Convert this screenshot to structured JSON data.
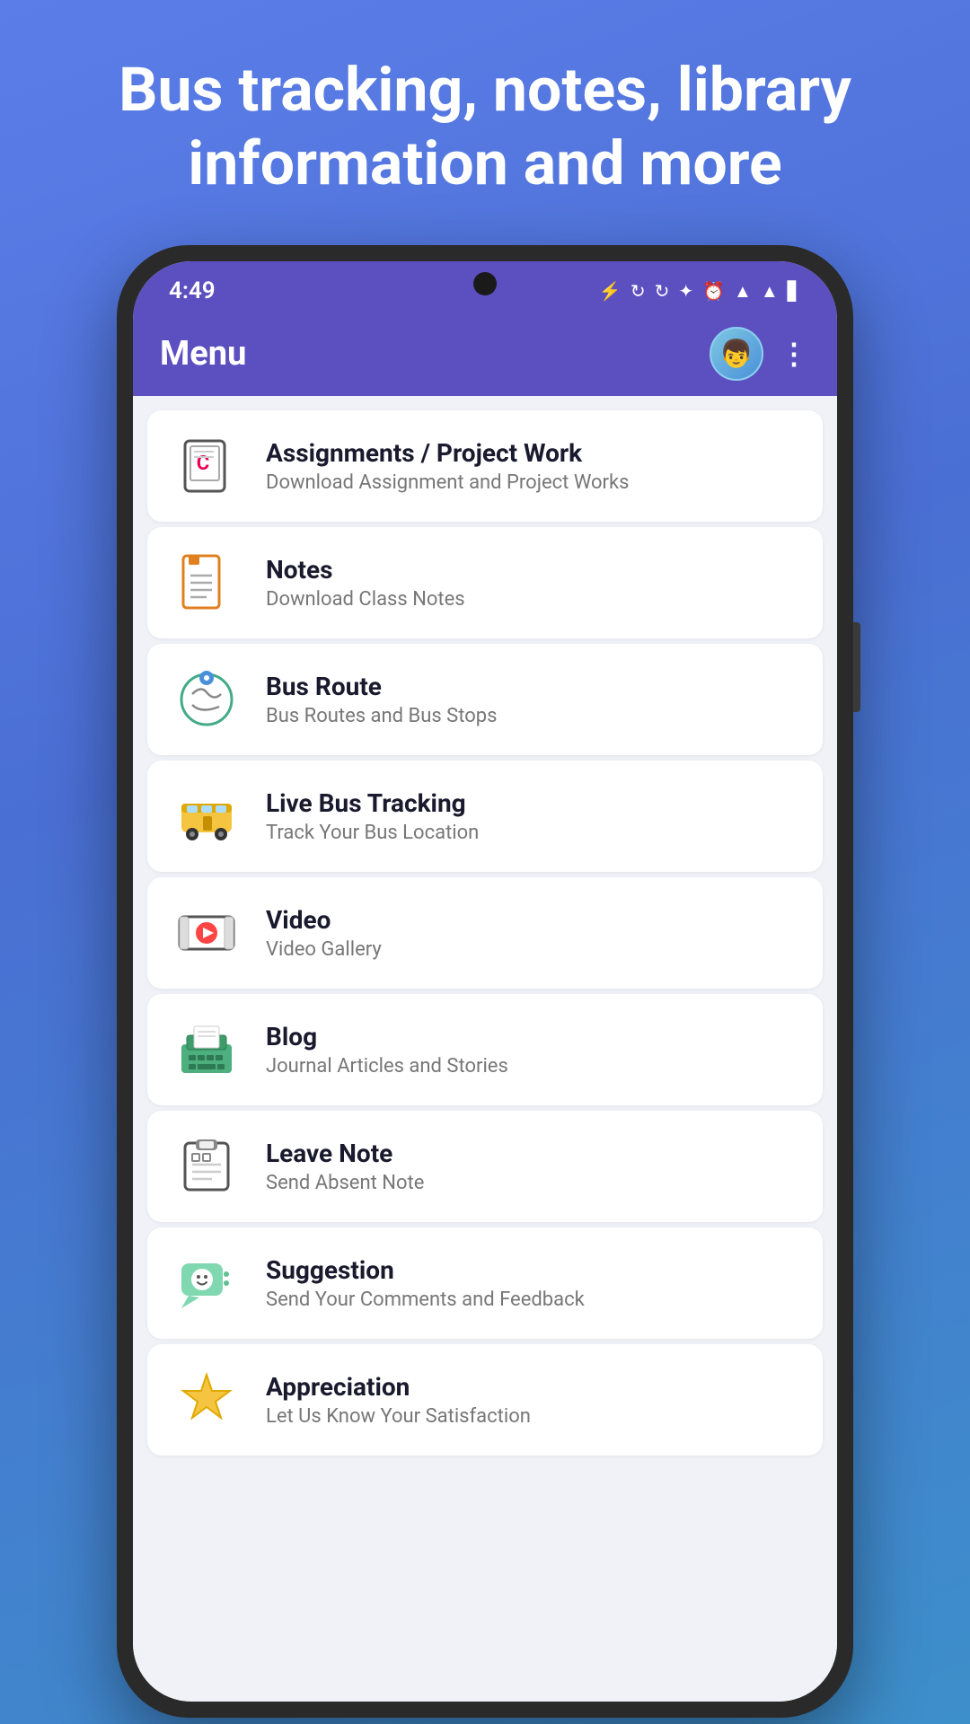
{
  "hero": {
    "title": "Bus tracking, notes, library information and more"
  },
  "status_bar": {
    "time": "4:49",
    "icons": [
      "🔋",
      "📶"
    ]
  },
  "top_bar": {
    "title": "Menu",
    "more_label": "⋮"
  },
  "menu_items": [
    {
      "id": "assignments",
      "title": "Assignments / Project Work",
      "subtitle": "Download Assignment and Project Works",
      "icon": "assignments"
    },
    {
      "id": "notes",
      "title": "Notes",
      "subtitle": "Download Class Notes",
      "icon": "notes"
    },
    {
      "id": "bus-route",
      "title": "Bus Route",
      "subtitle": "Bus Routes and Bus Stops",
      "icon": "bus-route"
    },
    {
      "id": "live-bus",
      "title": "Live Bus Tracking",
      "subtitle": "Track Your Bus Location",
      "icon": "live-bus"
    },
    {
      "id": "video",
      "title": "Video",
      "subtitle": "Video Gallery",
      "icon": "video"
    },
    {
      "id": "blog",
      "title": "Blog",
      "subtitle": "Journal Articles and Stories",
      "icon": "blog"
    },
    {
      "id": "leave-note",
      "title": "Leave Note",
      "subtitle": "Send Absent Note",
      "icon": "leave-note"
    },
    {
      "id": "suggestion",
      "title": "Suggestion",
      "subtitle": "Send Your Comments and Feedback",
      "icon": "suggestion"
    },
    {
      "id": "appreciation",
      "title": "Appreciation",
      "subtitle": "Let Us Know Your Satisfaction",
      "icon": "appreciation"
    }
  ]
}
